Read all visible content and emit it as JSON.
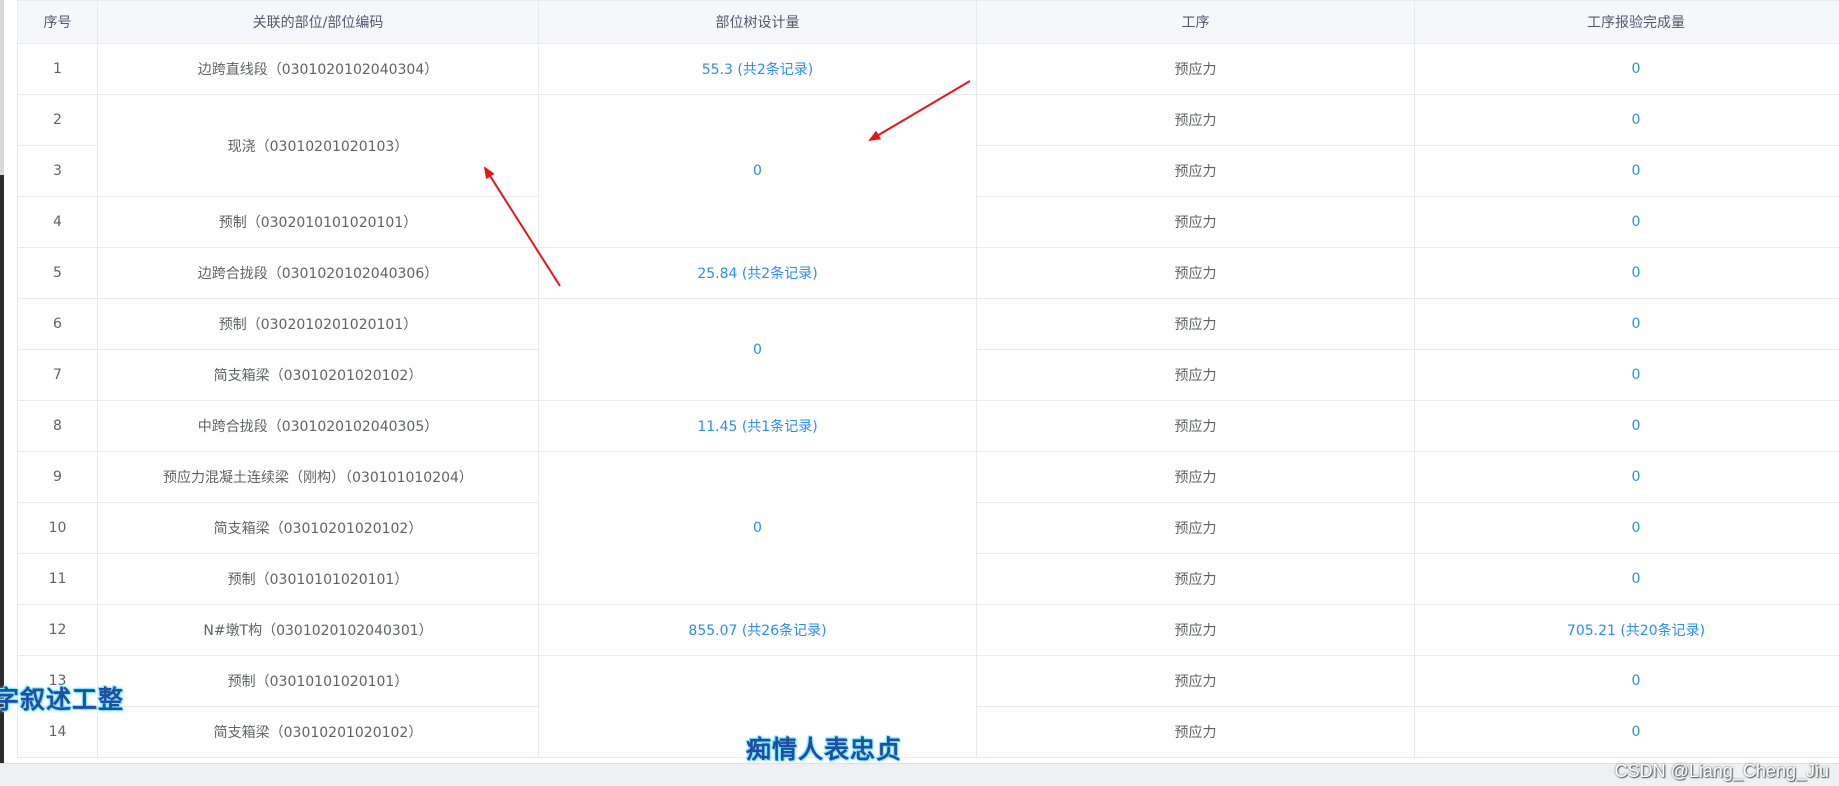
{
  "table": {
    "headers": {
      "index": "序号",
      "part": "关联的部位/部位编码",
      "design": "部位树设计量",
      "process": "工序",
      "done": "工序报验完成量"
    },
    "rows": [
      {
        "index": "1",
        "part": "边跨直线段（0301020102040304）",
        "design": "55.3 (共2条记录)",
        "process": "预应力",
        "done": "0"
      },
      {
        "index": "2",
        "part": "现浇（03010201020103）",
        "design": "0",
        "process": "预应力",
        "done": "0"
      },
      {
        "index": "3",
        "process": "预应力",
        "done": "0"
      },
      {
        "index": "4",
        "part": "预制（0302010101020101）",
        "process": "预应力",
        "done": "0"
      },
      {
        "index": "5",
        "part": "边跨合拢段（0301020102040306）",
        "design": "25.84 (共2条记录)",
        "process": "预应力",
        "done": "0"
      },
      {
        "index": "6",
        "part": "预制（0302010201020101）",
        "design": "0",
        "process": "预应力",
        "done": "0"
      },
      {
        "index": "7",
        "part": "简支箱梁（03010201020102）",
        "process": "预应力",
        "done": "0"
      },
      {
        "index": "8",
        "part": "中跨合拢段（0301020102040305）",
        "design": "11.45 (共1条记录)",
        "process": "预应力",
        "done": "0"
      },
      {
        "index": "9",
        "part": "预应力混凝土连续梁（刚构）（030101010204）",
        "design": "0",
        "process": "预应力",
        "done": "0"
      },
      {
        "index": "10",
        "part": "简支箱梁（03010201020102）",
        "process": "预应力",
        "done": "0"
      },
      {
        "index": "11",
        "part": "预制（03010101020101）",
        "process": "预应力",
        "done": "0"
      },
      {
        "index": "12",
        "part": "N#墩T构（0301020102040301）",
        "design": "855.07 (共26条记录)",
        "process": "预应力",
        "done": "705.21 (共20条记录)"
      },
      {
        "index": "13",
        "part": "预制（03010101020101）",
        "process": "预应力",
        "done": "0"
      },
      {
        "index": "14",
        "part": "简支箱梁（03010201020102）",
        "process": "预应力",
        "done": "0"
      }
    ]
  },
  "overlays": {
    "left_caption": "字叙述工整",
    "center_caption": "痴情人表忠贞",
    "watermark": "CSDN @Liang_Cheng_Jiu"
  },
  "colors": {
    "link": "#2d8cf0",
    "annotation_arrow": "#e8141b",
    "header_bg": "#f5f7fa",
    "border": "#e8eaec"
  },
  "icons": {
    "arrow_1": "red-arrow-pointing-up-left",
    "arrow_2": "red-arrow-pointing-down-left"
  }
}
